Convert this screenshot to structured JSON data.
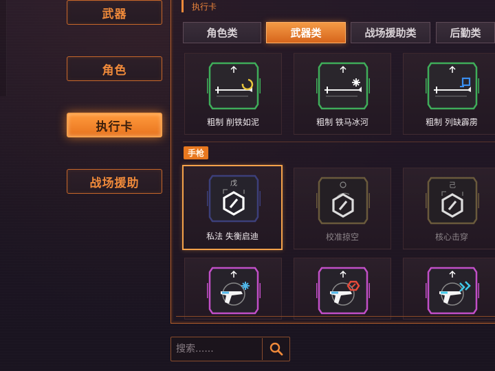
{
  "nav": {
    "items": [
      {
        "label": "武器",
        "active": false
      },
      {
        "label": "角色",
        "active": false
      },
      {
        "label": "执行卡",
        "active": true
      },
      {
        "label": "战场援助",
        "active": false
      }
    ]
  },
  "panel": {
    "title": "执行卡",
    "tabs": [
      {
        "label": "角色类",
        "active": false
      },
      {
        "label": "武器类",
        "active": true
      },
      {
        "label": "战场援助类",
        "active": false
      },
      {
        "label": "后勤类",
        "active": false
      }
    ]
  },
  "cards_top": [
    {
      "label": "粗制 削铁如泥",
      "frame_color": "#3fae5a",
      "icon": "sword-moon-icon"
    },
    {
      "label": "粗制 铁马冰河",
      "frame_color": "#3fae5a",
      "icon": "sword-snow-icon"
    },
    {
      "label": "粗制 列缺霹雳",
      "frame_color": "#3fae5a",
      "icon": "sword-lightning-icon"
    }
  ],
  "section": {
    "label": "手枪"
  },
  "cards_pistol": [
    {
      "label": "私法 失衡启迪",
      "frame_color": "#3c3f7a",
      "top_glyph": "戊",
      "selected": true,
      "dim": false,
      "icon": "hex-slash-icon"
    },
    {
      "label": "校准掠空",
      "frame_color": "#6a5a3c",
      "top_glyph": "",
      "selected": false,
      "dim": true,
      "icon": "hex-slash-icon"
    },
    {
      "label": "核心击穿",
      "frame_color": "#6a5a3c",
      "top_glyph": "己",
      "selected": false,
      "dim": true,
      "icon": "hex-slash-icon"
    }
  ],
  "cards_bottom": [
    {
      "frame_color": "#c24fc8",
      "accent": "#4fb6e8",
      "icon": "pistol-frost-icon"
    },
    {
      "frame_color": "#c24fc8",
      "accent": "#e84a3a",
      "icon": "pistol-fire-icon"
    },
    {
      "frame_color": "#c24fc8",
      "accent": "#3fc8e8",
      "icon": "pistol-chain-icon"
    }
  ],
  "search": {
    "placeholder": "搜索......"
  },
  "colors": {
    "accent": "#f08a3a",
    "active_fill": "#e8741f"
  }
}
